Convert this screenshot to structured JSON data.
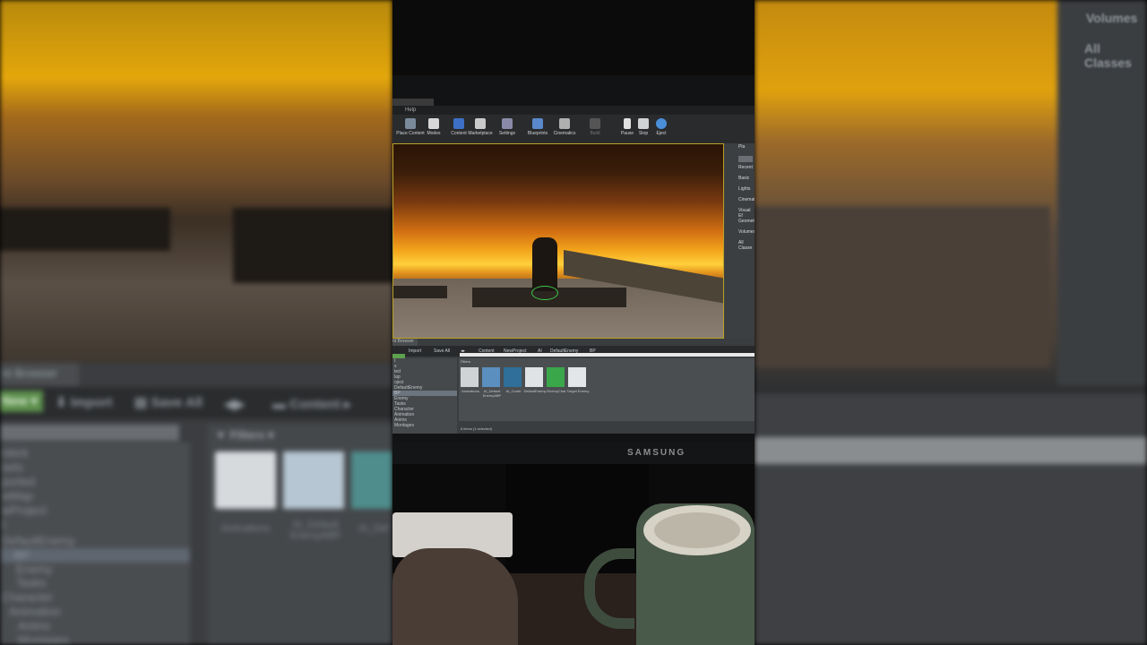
{
  "background_left": {
    "tab": "nt Browser",
    "add_new": "New ▾",
    "import": "Import",
    "save_all": "Save All",
    "path_content": "Content",
    "filters": "Filters",
    "tree": [
      "ntent",
      "sets",
      "ported",
      "wMap",
      "wProject",
      "I",
      "DefaultEnemy",
      "BP",
      "Enemy",
      "Tasks",
      "Character",
      "Animation",
      "Anims",
      "Montages"
    ],
    "thumbs": [
      "Animations",
      "AI_Default EnemyABP",
      "AI_Def"
    ]
  },
  "background_right": {
    "items": [
      "Volumes",
      "All Classes"
    ]
  },
  "editor": {
    "menu": "Help",
    "toolbar": [
      {
        "label": "Place Content",
        "color": "#7a8a9a"
      },
      {
        "label": "Modes",
        "color": "#d8d8d8"
      },
      {
        "label": "Content",
        "color": "#3d6fc4"
      },
      {
        "label": "Marketplace",
        "color": "#c9c9c9"
      },
      {
        "label": "Settings",
        "color": "#8a8aa8"
      },
      {
        "label": "Blueprints",
        "color": "#5a88cc"
      },
      {
        "label": "Cinematics",
        "color": "#b0b0b0"
      },
      {
        "label": "Build",
        "color": "#555555"
      },
      {
        "label": "Pause",
        "color": "#e0e0e0"
      },
      {
        "label": "Stop",
        "color": "#cfd3d6"
      },
      {
        "label": "Eject",
        "color": "#4a8ed8"
      }
    ],
    "details_panel": {
      "title": "Pla",
      "items": [
        "Recent",
        "Basic",
        "Lights",
        "Cinemati",
        "Visual Ef",
        "Geometry",
        "Volumes",
        "All Classe"
      ]
    },
    "content_browser": {
      "tab": "nt Browser",
      "bar": [
        "Import",
        "Save All",
        "Content",
        "NewProject",
        "AI",
        "DefaultEnemy",
        "BP"
      ],
      "filters": "Filters",
      "tree": [
        "t",
        "s",
        "ted",
        "lap",
        "oject",
        "DefaultEnemy",
        "BP",
        "Enemy",
        "Tasks",
        "Character",
        "Animation",
        "Anims",
        "Montages",
        "Assets"
      ],
      "assets": [
        {
          "label": "Animations",
          "color": "#cfd3d6"
        },
        {
          "label": "AI_Default EnemyABP",
          "color": "#5a8fbf"
        },
        {
          "label": "AI_Contrl",
          "color": "#2f6f9a"
        },
        {
          "label": "DefaultEnemy",
          "color": "#dfe3e6"
        },
        {
          "label": "EnemyChar",
          "color": "#3aa84a"
        },
        {
          "label": "Target Enemy",
          "color": "#e2e6e9"
        }
      ],
      "status": "6 items (1 selected)"
    }
  },
  "monitor": {
    "brand": "SAMSUNG"
  }
}
